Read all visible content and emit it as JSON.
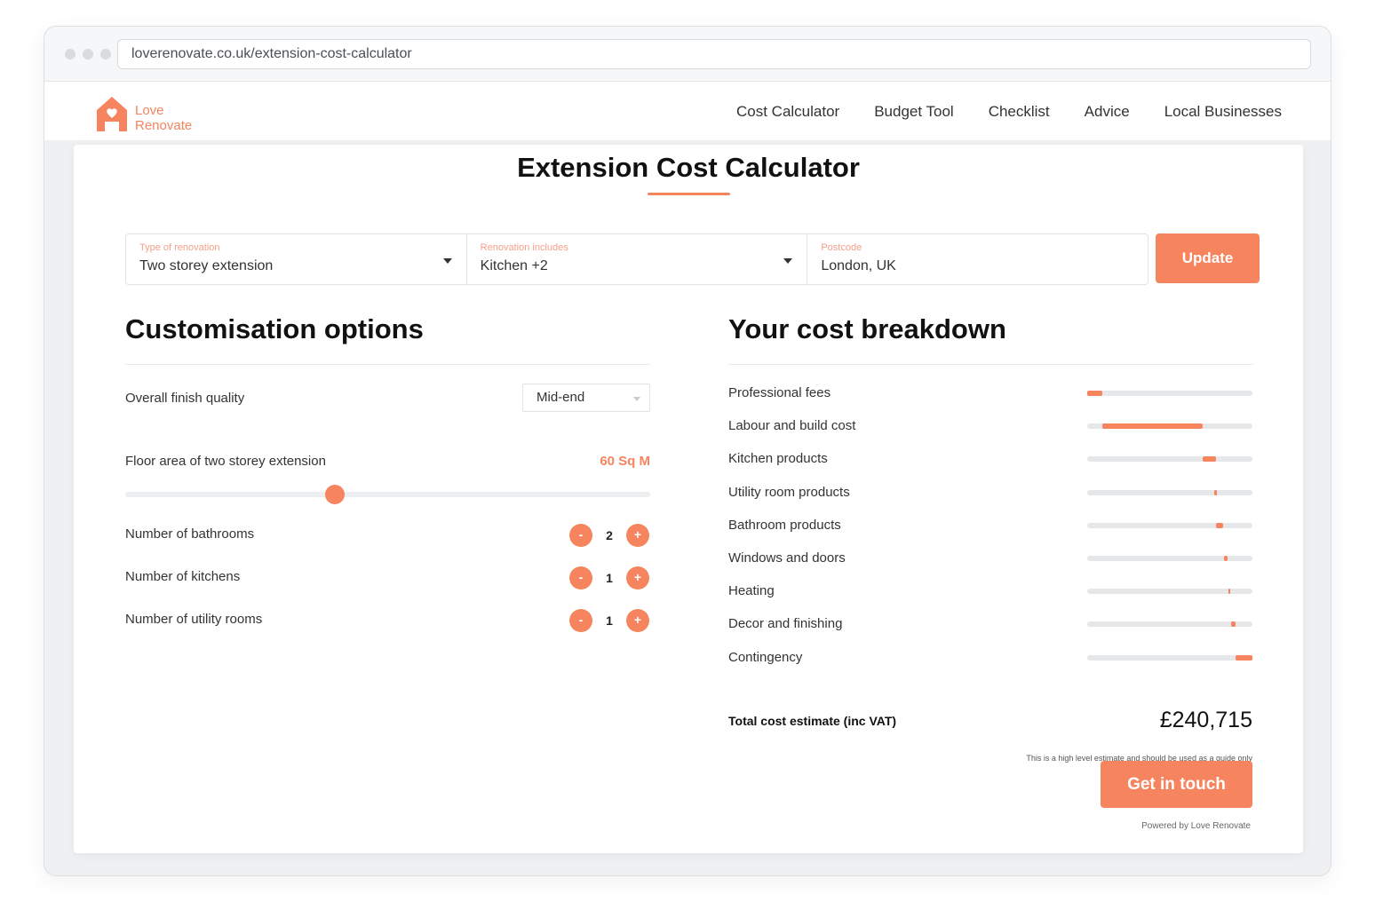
{
  "browser": {
    "url": "loverenovate.co.uk/extension-cost-calculator"
  },
  "brand": {
    "line1": "Love",
    "line2": "Renovate",
    "accent": "#f5845f"
  },
  "nav": [
    "Cost Calculator",
    "Budget Tool",
    "Checklist",
    "Advice",
    "Local Businesses"
  ],
  "page": {
    "title": "Extension Cost Calculator"
  },
  "filters": {
    "type": {
      "label": "Type of renovation",
      "value": "Two storey extension"
    },
    "includes": {
      "label": "Renovation includes",
      "value": "Kitchen +2"
    },
    "postcode": {
      "label": "Postcode",
      "value": "London, UK"
    },
    "update_label": "Update"
  },
  "customisation": {
    "heading": "Customisation options",
    "finish": {
      "label": "Overall finish quality",
      "value": "Mid-end"
    },
    "area": {
      "label": "Floor area of two storey extension",
      "value": "60 Sq M",
      "slider_fraction": 0.4
    },
    "steppers": [
      {
        "label": "Number of bathrooms",
        "value": "2",
        "minus": "-",
        "plus": "+"
      },
      {
        "label": "Number of kitchens",
        "value": "1",
        "minus": "-",
        "plus": "+"
      },
      {
        "label": "Number of utility rooms",
        "value": "1",
        "minus": "-",
        "plus": "+"
      }
    ]
  },
  "breakdown": {
    "heading": "Your cost breakdown",
    "items": [
      {
        "label": "Professional fees",
        "start": 0.0,
        "end": 0.09
      },
      {
        "label": "Labour and build cost",
        "start": 0.09,
        "end": 0.7
      },
      {
        "label": "Kitchen products",
        "start": 0.7,
        "end": 0.78
      },
      {
        "label": "Utility room products",
        "start": 0.77,
        "end": 0.785
      },
      {
        "label": "Bathroom products",
        "start": 0.78,
        "end": 0.82
      },
      {
        "label": "Windows and doors",
        "start": 0.83,
        "end": 0.85
      },
      {
        "label": "Heating",
        "start": 0.855,
        "end": 0.865
      },
      {
        "label": "Decor and finishing",
        "start": 0.87,
        "end": 0.9
      },
      {
        "label": "Contingency",
        "start": 0.9,
        "end": 1.0
      }
    ],
    "total_label": "Total cost estimate (inc VAT)",
    "total_value": "£240,715",
    "disclaimer": "This is a high level estimate and should be used as a guide only",
    "cta_label": "Get in touch",
    "powered_by": "Powered by Love Renovate"
  }
}
